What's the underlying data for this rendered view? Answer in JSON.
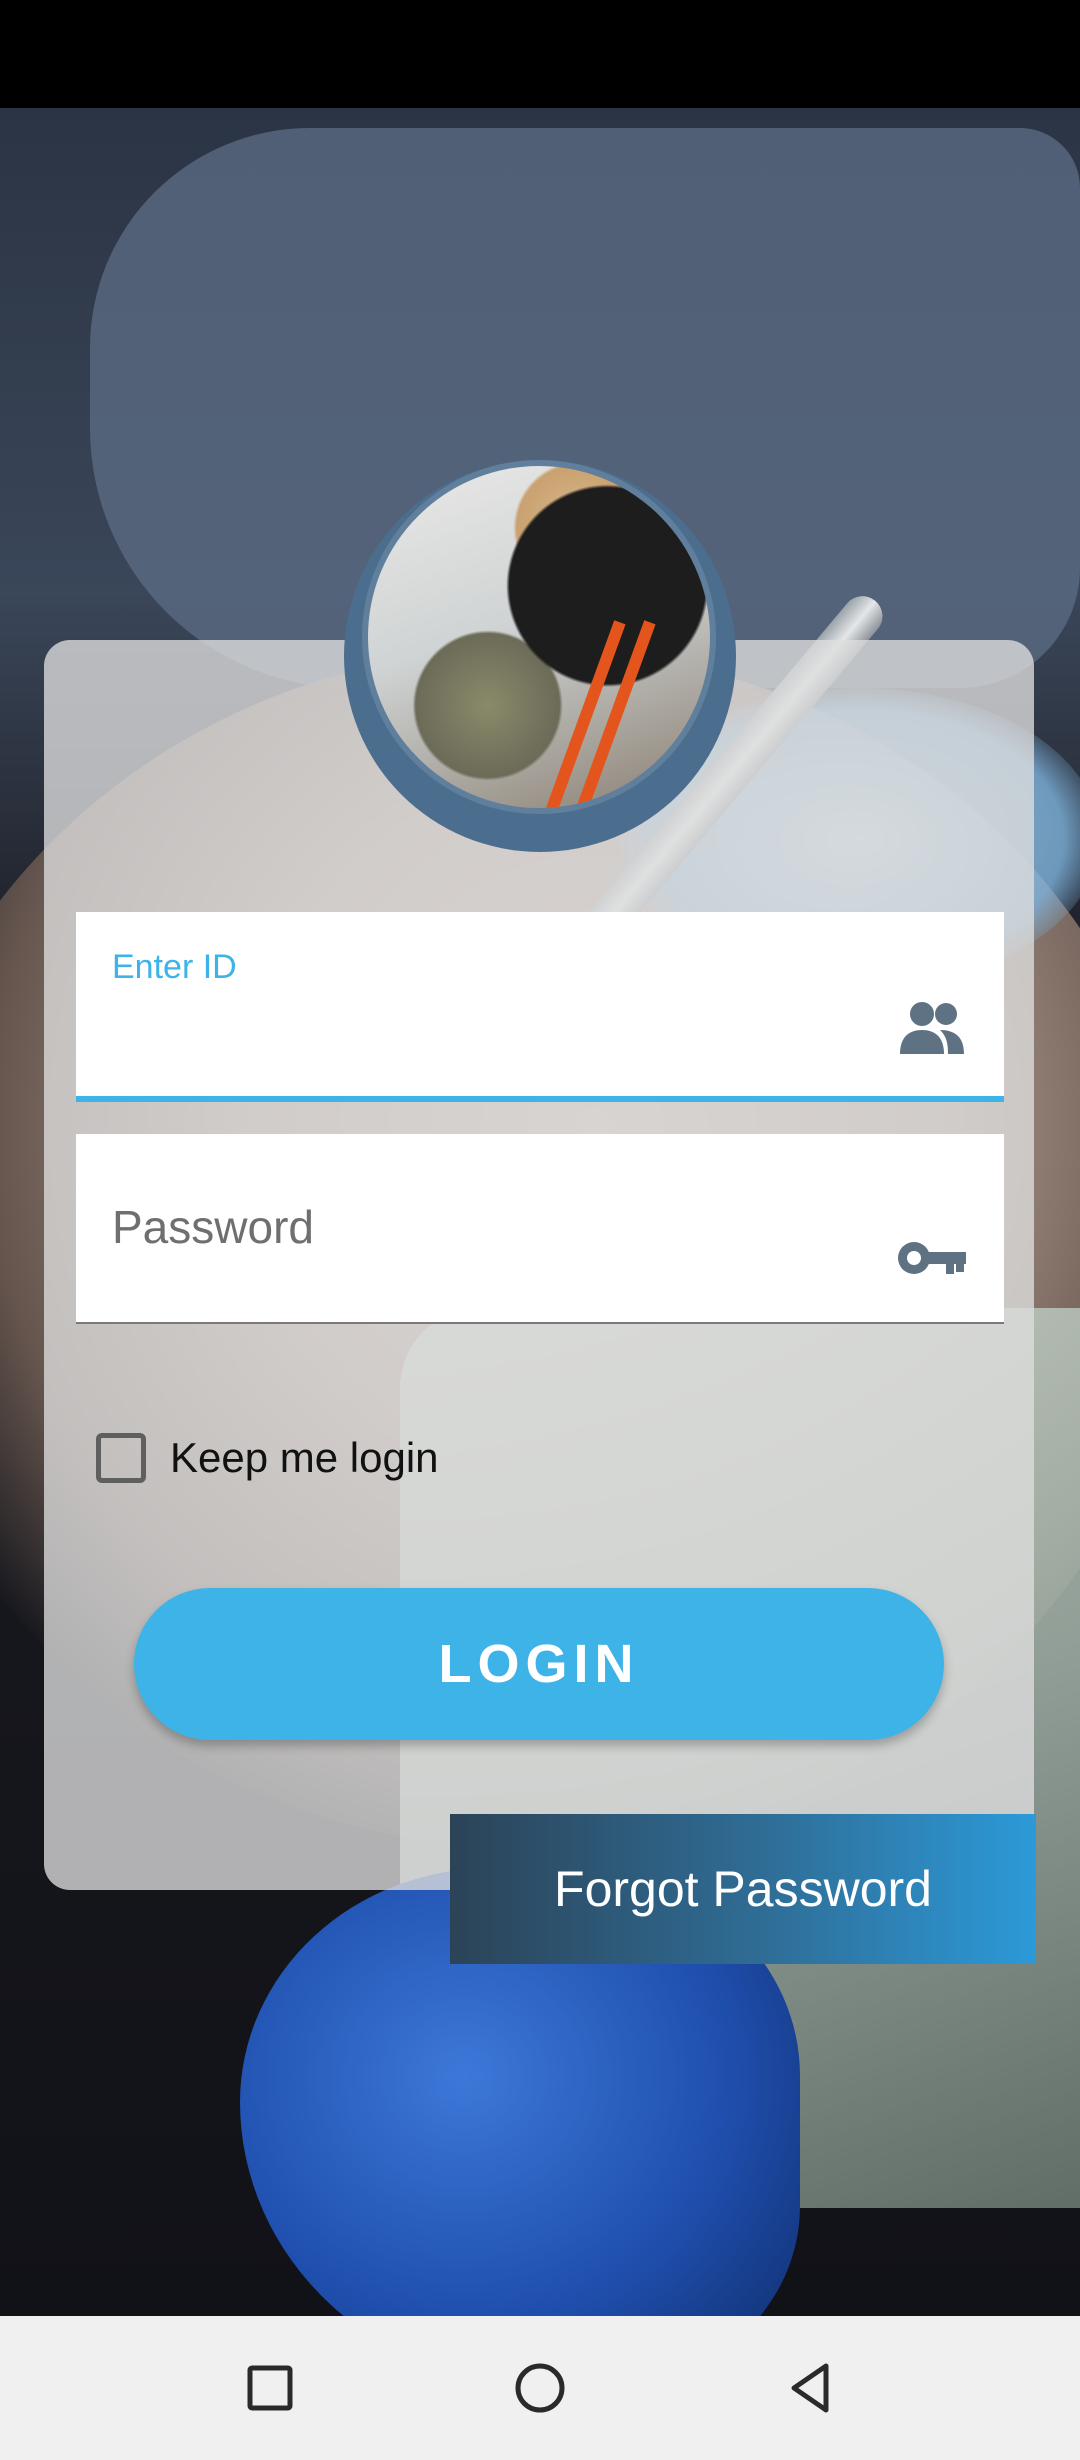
{
  "login_form": {
    "id_label": "Enter ID",
    "password_placeholder": "Password",
    "keep_login_label": "Keep me login",
    "login_button": "LOGIN",
    "forgot_password": "Forgot Password"
  },
  "icons": {
    "id_field_icon": "people-icon",
    "password_field_icon": "key-icon",
    "nav_recents": "square-icon",
    "nav_home": "circle-icon",
    "nav_back": "triangle-back-icon"
  },
  "colors": {
    "accent": "#3db3e8",
    "avatar_ring": "#4c6e8e",
    "forgot_gradient_start": "#2c4357",
    "forgot_gradient_end": "#2c9ad8",
    "icon_gray": "#5f7284"
  }
}
